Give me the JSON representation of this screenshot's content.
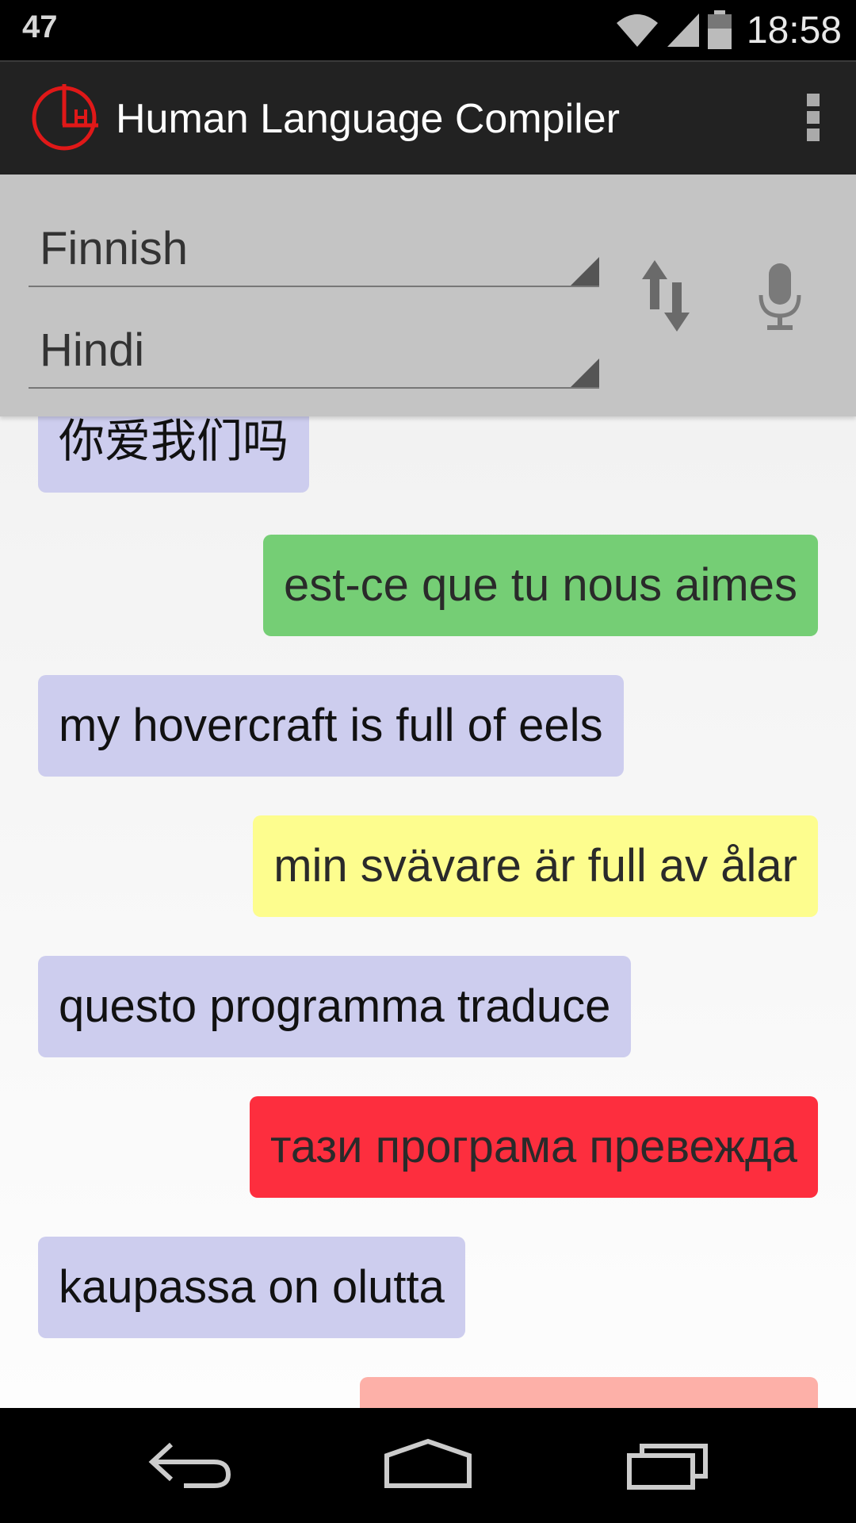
{
  "status_bar": {
    "notification_count": "47",
    "time": "18:58",
    "icons": [
      "wifi-icon",
      "cell-signal-icon",
      "battery-icon"
    ]
  },
  "action_bar": {
    "title": "Human Language Compiler",
    "logo_icon": "clock-logo-icon",
    "overflow_icon": "overflow-menu-icon"
  },
  "languages": {
    "from": "Finnish",
    "to": "Hindi",
    "swap_icon": "swap-vertical-icon",
    "mic_icon": "microphone-icon"
  },
  "messages": [
    {
      "text": "你爱我们吗",
      "side": "left",
      "color": "#cdcdee"
    },
    {
      "text": "est-ce que tu nous aimes",
      "side": "right",
      "color": "#75ce75"
    },
    {
      "text": "my hovercraft is full of eels",
      "side": "left",
      "color": "#cdcdee"
    },
    {
      "text": "min svävare är full av ålar",
      "side": "right",
      "color": "#fdfd8e"
    },
    {
      "text": "questo programma traduce",
      "side": "left",
      "color": "#cdcdee"
    },
    {
      "text": "тази програма превежда",
      "side": "right",
      "color": "#fd2e3e"
    },
    {
      "text": "kaupassa on olutta",
      "side": "left",
      "color": "#cdcdee"
    },
    {
      "text": "",
      "side": "right",
      "color": "#fdb0a8"
    }
  ],
  "nav_bar": {
    "icons": [
      "back-icon",
      "home-icon",
      "recent-apps-icon"
    ]
  }
}
